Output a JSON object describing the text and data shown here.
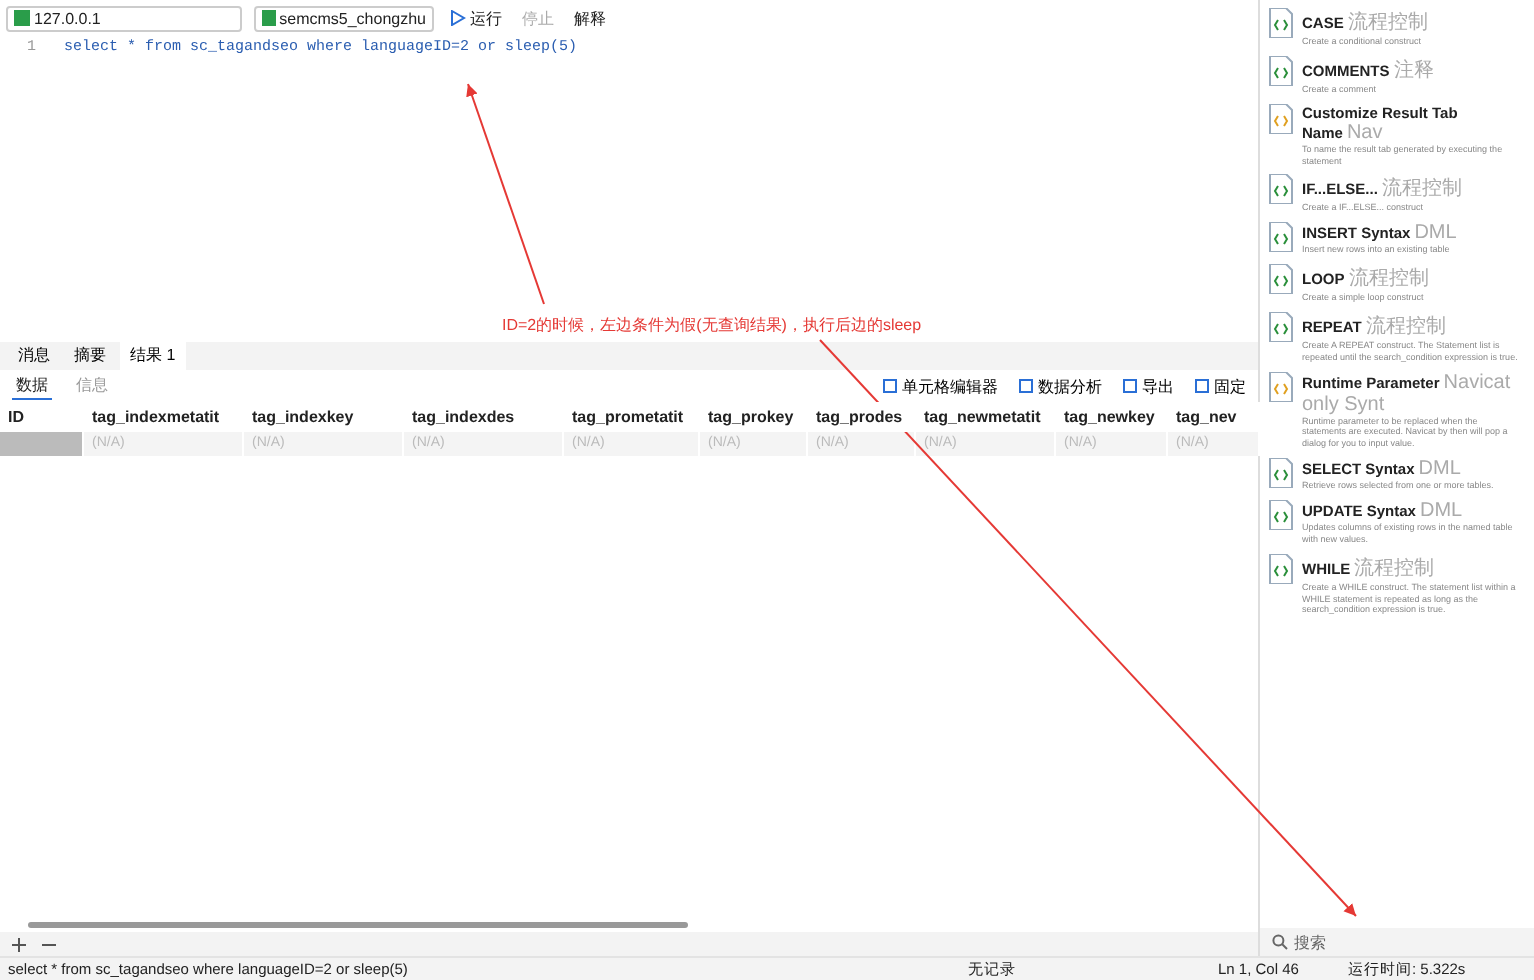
{
  "toolbar": {
    "connection": "127.0.0.1",
    "database": "semcms5_chongzhu",
    "run": "运行",
    "stop": "停止",
    "explain": "解释"
  },
  "editor": {
    "lines": [
      {
        "number": "1",
        "code": "select * from sc_tagandseo where languageID=2 or sleep(5)"
      }
    ]
  },
  "annotation": {
    "text": "ID=2的时候，左边条件为假(无查询结果)，执行后边的sleep"
  },
  "result_tabs": [
    {
      "label": "消息",
      "selected": false
    },
    {
      "label": "摘要",
      "selected": false
    },
    {
      "label": "结果 1",
      "selected": true
    }
  ],
  "sub_tabs": [
    {
      "label": "数据",
      "selected": true
    },
    {
      "label": "信息",
      "selected": false
    }
  ],
  "result_actions": [
    "单元格编辑器",
    "数据分析",
    "导出",
    "固定"
  ],
  "table": {
    "columns": [
      "ID",
      "tag_indexmetatit",
      "tag_indexkey",
      "tag_indexdes",
      "tag_prometatit",
      "tag_prokey",
      "tag_prodes",
      "tag_newmetatit",
      "tag_newkey",
      "tag_nev"
    ],
    "rows": [
      {
        "cells": [
          "",
          "(N/A)",
          "(N/A)",
          "(N/A)",
          "(N/A)",
          "(N/A)",
          "(N/A)",
          "(N/A)",
          "(N/A)",
          "(N/A)"
        ]
      }
    ]
  },
  "snippets": [
    {
      "title": "CASE",
      "tag": "流程控制",
      "desc": "Create a conditional construct",
      "kind": "code"
    },
    {
      "title": "COMMENTS",
      "tag": "注释",
      "desc": "Create a comment",
      "kind": "code"
    },
    {
      "title": "Customize Result Tab Name",
      "tag": "Nav",
      "desc": "To name the result tab generated by executing the statement",
      "kind": "navicat"
    },
    {
      "title": "IF...ELSE...",
      "tag": "流程控制",
      "desc": "Create a IF...ELSE... construct",
      "kind": "code"
    },
    {
      "title": "INSERT Syntax",
      "tag": "DML",
      "desc": "Insert new rows into an existing table",
      "kind": "code"
    },
    {
      "title": "LOOP",
      "tag": "流程控制",
      "desc": "Create a simple loop construct",
      "kind": "code"
    },
    {
      "title": "REPEAT",
      "tag": "流程控制",
      "desc": "Create A REPEAT construct. The Statement list is repeated until the search_condition expression is true.",
      "kind": "code"
    },
    {
      "title": "Runtime Parameter",
      "tag": "Navicat only Synt",
      "desc": "Runtime parameter to be replaced when the statements are executed. Navicat by then will pop a dialog for you to input value.",
      "kind": "navicat"
    },
    {
      "title": "SELECT Syntax",
      "tag": "DML",
      "desc": "Retrieve rows selected from one or more tables.",
      "kind": "code"
    },
    {
      "title": "UPDATE Syntax",
      "tag": "DML",
      "desc": "Updates columns of existing rows in the named table with new values.",
      "kind": "code"
    },
    {
      "title": "WHILE",
      "tag": "流程控制",
      "desc": "Create a WHILE construct. The statement list within a WHILE statement is repeated as long as the search_condition expression is true.",
      "kind": "code"
    }
  ],
  "search": {
    "placeholder": "搜索"
  },
  "status_bar": {
    "query": "select * from sc_tagandseo where languageID=2 or sleep(5)",
    "records": "无记录",
    "position": "Ln 1, Col 46",
    "time": "运行时间: 5.322s"
  }
}
